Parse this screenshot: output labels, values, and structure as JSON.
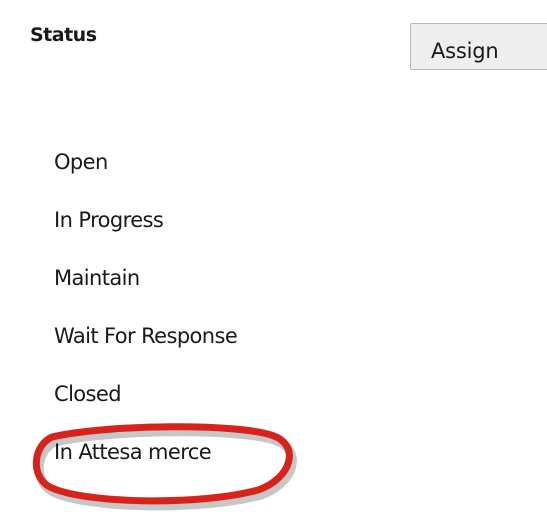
{
  "header": {
    "title": "Status",
    "assign_label": "Assign"
  },
  "status_options": [
    "Open",
    "In Progress",
    "Maintain",
    "Wait For Response",
    "Closed",
    "In Attesa merce"
  ],
  "highlight": {
    "target": "In Attesa merce",
    "color": "#d6231c"
  }
}
